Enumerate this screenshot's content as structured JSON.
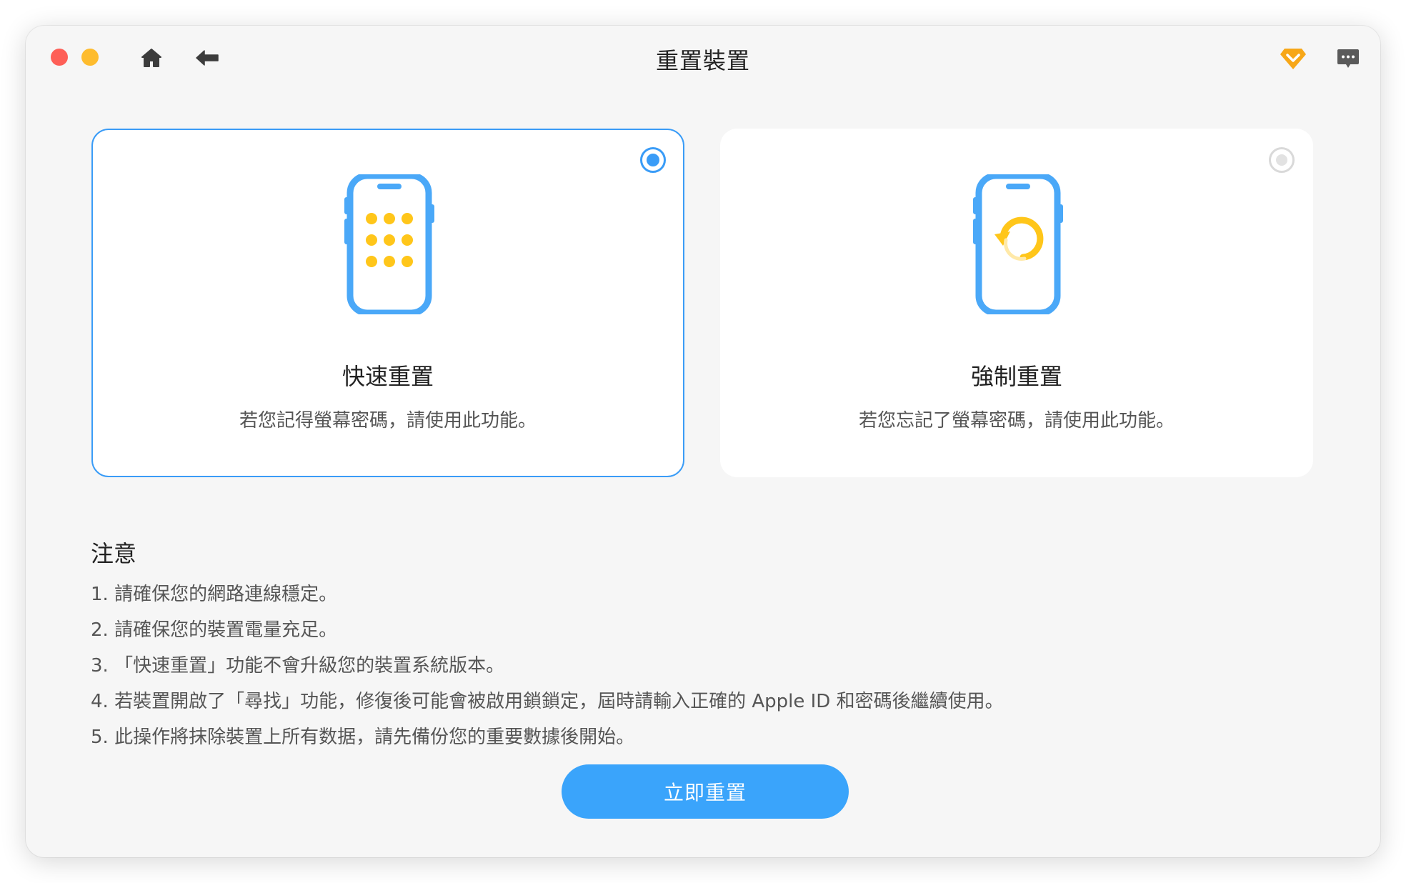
{
  "window": {
    "title": "重置裝置"
  },
  "toolbar": {
    "home_icon": "home-icon",
    "back_icon": "back-arrow-icon",
    "premium_icon": "diamond-icon",
    "feedback_icon": "chat-bubble-icon"
  },
  "options": [
    {
      "title": "快速重置",
      "description": "若您記得螢幕密碼，請使用此功能。",
      "icon": "phone-keypad-icon",
      "selected": true
    },
    {
      "title": "強制重置",
      "description": "若您忘記了螢幕密碼，請使用此功能。",
      "icon": "phone-reset-icon",
      "selected": false
    }
  ],
  "notes": {
    "title": "注意",
    "items": [
      "1. 請確保您的網路連線穩定。",
      "2. 請確保您的裝置電量充足。",
      "3. 「快速重置」功能不會升級您的裝置系統版本。",
      "4. 若裝置開啟了「尋找」功能，修復後可能會被啟用鎖鎖定，屆時請輸入正確的 Apple ID 和密碼後繼續使用。",
      "5. 此操作將抹除裝置上所有数据，請先備份您的重要數據後開始。"
    ]
  },
  "action": {
    "label": "立即重置"
  },
  "colors": {
    "accent": "#3a9cf7",
    "button": "#3aa4fb",
    "icon_yellow": "#ffc61a",
    "premium": "#f7a718"
  }
}
